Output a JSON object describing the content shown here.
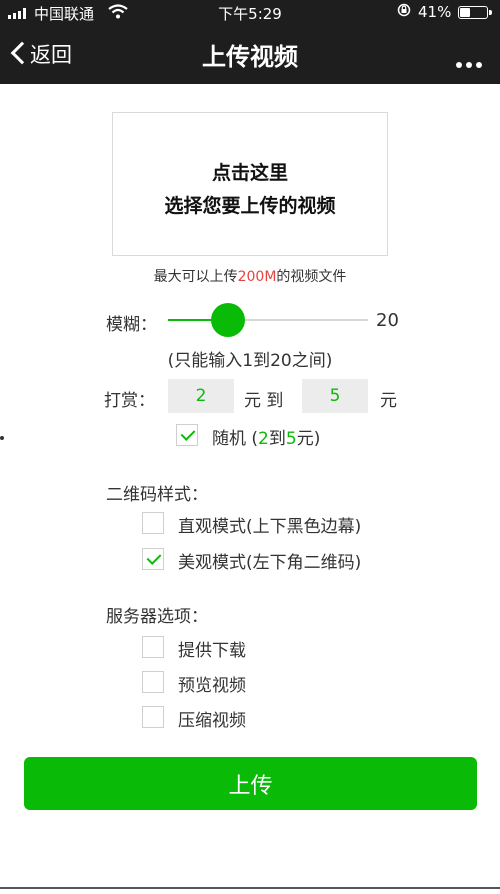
{
  "status": {
    "carrier": "中国联通",
    "time": "下午5:29",
    "battery_pct": "41%",
    "battery_level": 0.41
  },
  "nav": {
    "back_label": "返回",
    "title": "上传视频",
    "more_label": "•••"
  },
  "upload": {
    "line1": "点击这里",
    "line2": "选择您要上传的视频",
    "hint_prefix": "最大可以上传",
    "hint_size": "200M",
    "hint_suffix": "的视频文件"
  },
  "blur": {
    "label": "模糊：",
    "value": 20,
    "value_text": "20",
    "slider_level": 0.3,
    "note": "(只能输入1到20之间)"
  },
  "reward": {
    "label": "打赏：",
    "min": "2",
    "yuan_to": "元 到",
    "max": "5",
    "yuan": "元",
    "random_label": "随机 (",
    "random_min": "2",
    "random_to": "到",
    "random_max": "5",
    "random_suffix": "元)",
    "random_checked": true
  },
  "qr_style": {
    "heading": "二维码样式：",
    "options": [
      {
        "label": "直观模式(上下黑色边幕)",
        "checked": false
      },
      {
        "label": "美观模式(左下角二维码)",
        "checked": true
      }
    ]
  },
  "server": {
    "heading": "服务器选项：",
    "options": [
      {
        "label": "提供下载",
        "checked": false
      },
      {
        "label": "预览视频",
        "checked": false
      },
      {
        "label": "压缩视频",
        "checked": false
      }
    ]
  },
  "submit_label": "上传",
  "colors": {
    "accent": "#09bb07",
    "highlight": "#e64340",
    "nav_bg": "#1e1e1e"
  }
}
